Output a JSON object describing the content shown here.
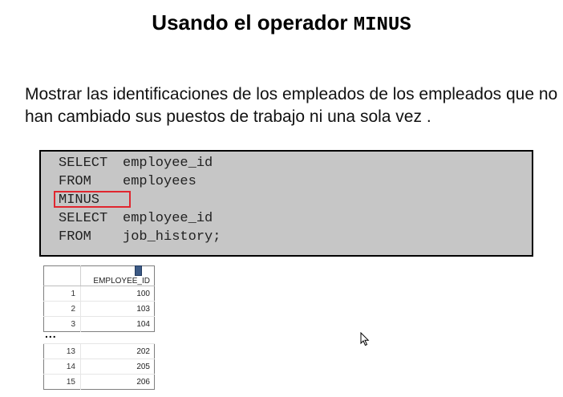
{
  "slide": {
    "title_prefix": "Usando el operador ",
    "title_keyword": "MINUS",
    "description": "Mostrar las identificaciones de los empleados de los empleados que no han cambiado sus puestos de trabajo ni una sola vez ."
  },
  "code": {
    "lines": [
      {
        "keyword": "SELECT",
        "rest": "employee_id"
      },
      {
        "keyword": "FROM",
        "rest": "employees"
      },
      {
        "keyword": "MINUS",
        "rest": ""
      },
      {
        "keyword": "SELECT",
        "rest": "employee_id"
      },
      {
        "keyword": "FROM",
        "rest": "job_history;"
      }
    ],
    "highlight_color": "#e0262f",
    "background_color": "#c6c6c6"
  },
  "result": {
    "column_header": "EMPLOYEE_ID",
    "sort_icon": "sort-icon",
    "top_rows": [
      {
        "num": "1",
        "value": "100"
      },
      {
        "num": "2",
        "value": "103"
      },
      {
        "num": "3",
        "value": "104"
      }
    ],
    "ellipsis": "...",
    "bottom_rows": [
      {
        "num": "13",
        "value": "202"
      },
      {
        "num": "14",
        "value": "205"
      },
      {
        "num": "15",
        "value": "206"
      }
    ]
  },
  "cursor_icon": "mouse-pointer-icon"
}
